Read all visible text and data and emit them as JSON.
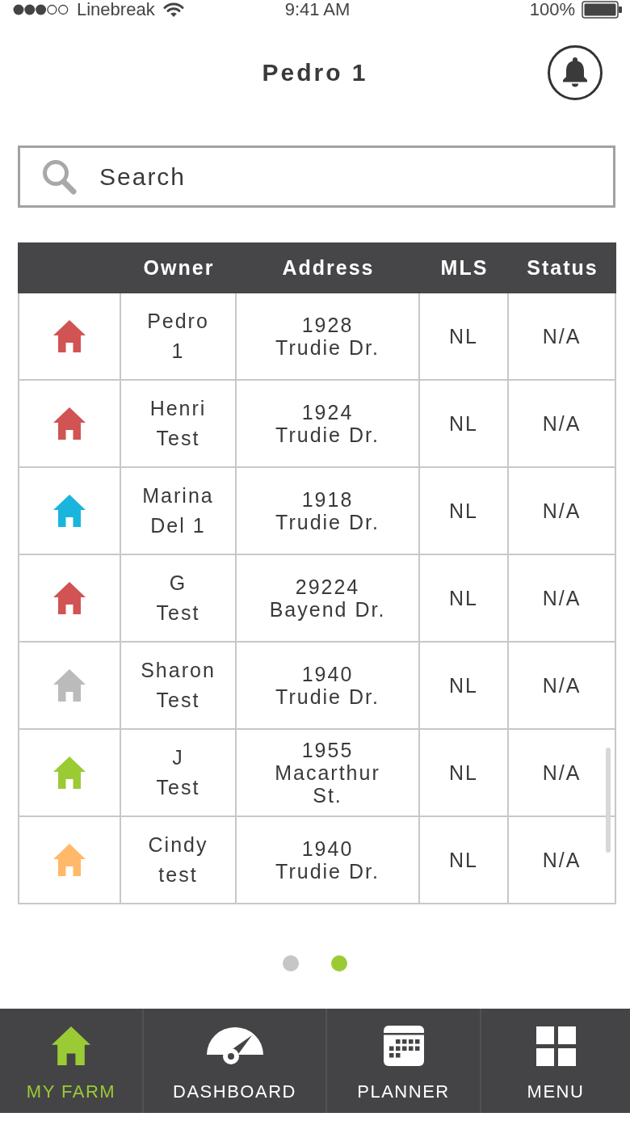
{
  "status_bar": {
    "carrier": "Linebreak",
    "time": "9:41 AM",
    "battery": "100%"
  },
  "header": {
    "title": "Pedro 1"
  },
  "search": {
    "placeholder": "Search"
  },
  "table": {
    "columns": [
      "Owner",
      "Address",
      "MLS",
      "Status"
    ],
    "rows": [
      {
        "color": "#d15353",
        "owner": "Pedro\n1",
        "address": "1928\nTrudie Dr.",
        "mls": "NL",
        "status": "N/A"
      },
      {
        "color": "#d15353",
        "owner": "Henri\nTest",
        "address": "1924\nTrudie Dr.",
        "mls": "NL",
        "status": "N/A"
      },
      {
        "color": "#1ab5dc",
        "owner": "Marina\nDel 1",
        "address": "1918\nTrudie Dr.",
        "mls": "NL",
        "status": "N/A"
      },
      {
        "color": "#d15353",
        "owner": "G\nTest",
        "address": "29224\nBayend Dr.",
        "mls": "NL",
        "status": "N/A"
      },
      {
        "color": "#bbbbbb",
        "owner": "Sharon\nTest",
        "address": "1940\nTrudie Dr.",
        "mls": "NL",
        "status": "N/A"
      },
      {
        "color": "#9bcb34",
        "owner": "J\nTest",
        "address": "1955\nMacarthur\nSt.",
        "mls": "NL",
        "status": "N/A"
      },
      {
        "color": "#ffb968",
        "owner": "Cindy\ntest",
        "address": "1940\nTrudie Dr.",
        "mls": "NL",
        "status": "N/A"
      }
    ]
  },
  "pagination": [
    {
      "selected": false
    },
    {
      "selected": true
    }
  ],
  "tabs": [
    {
      "label": "MY FARM",
      "selected": true
    },
    {
      "label": "DASHBOARD",
      "selected": false
    },
    {
      "label": "PLANNER",
      "selected": false
    },
    {
      "label": "MENU",
      "selected": false
    }
  ]
}
